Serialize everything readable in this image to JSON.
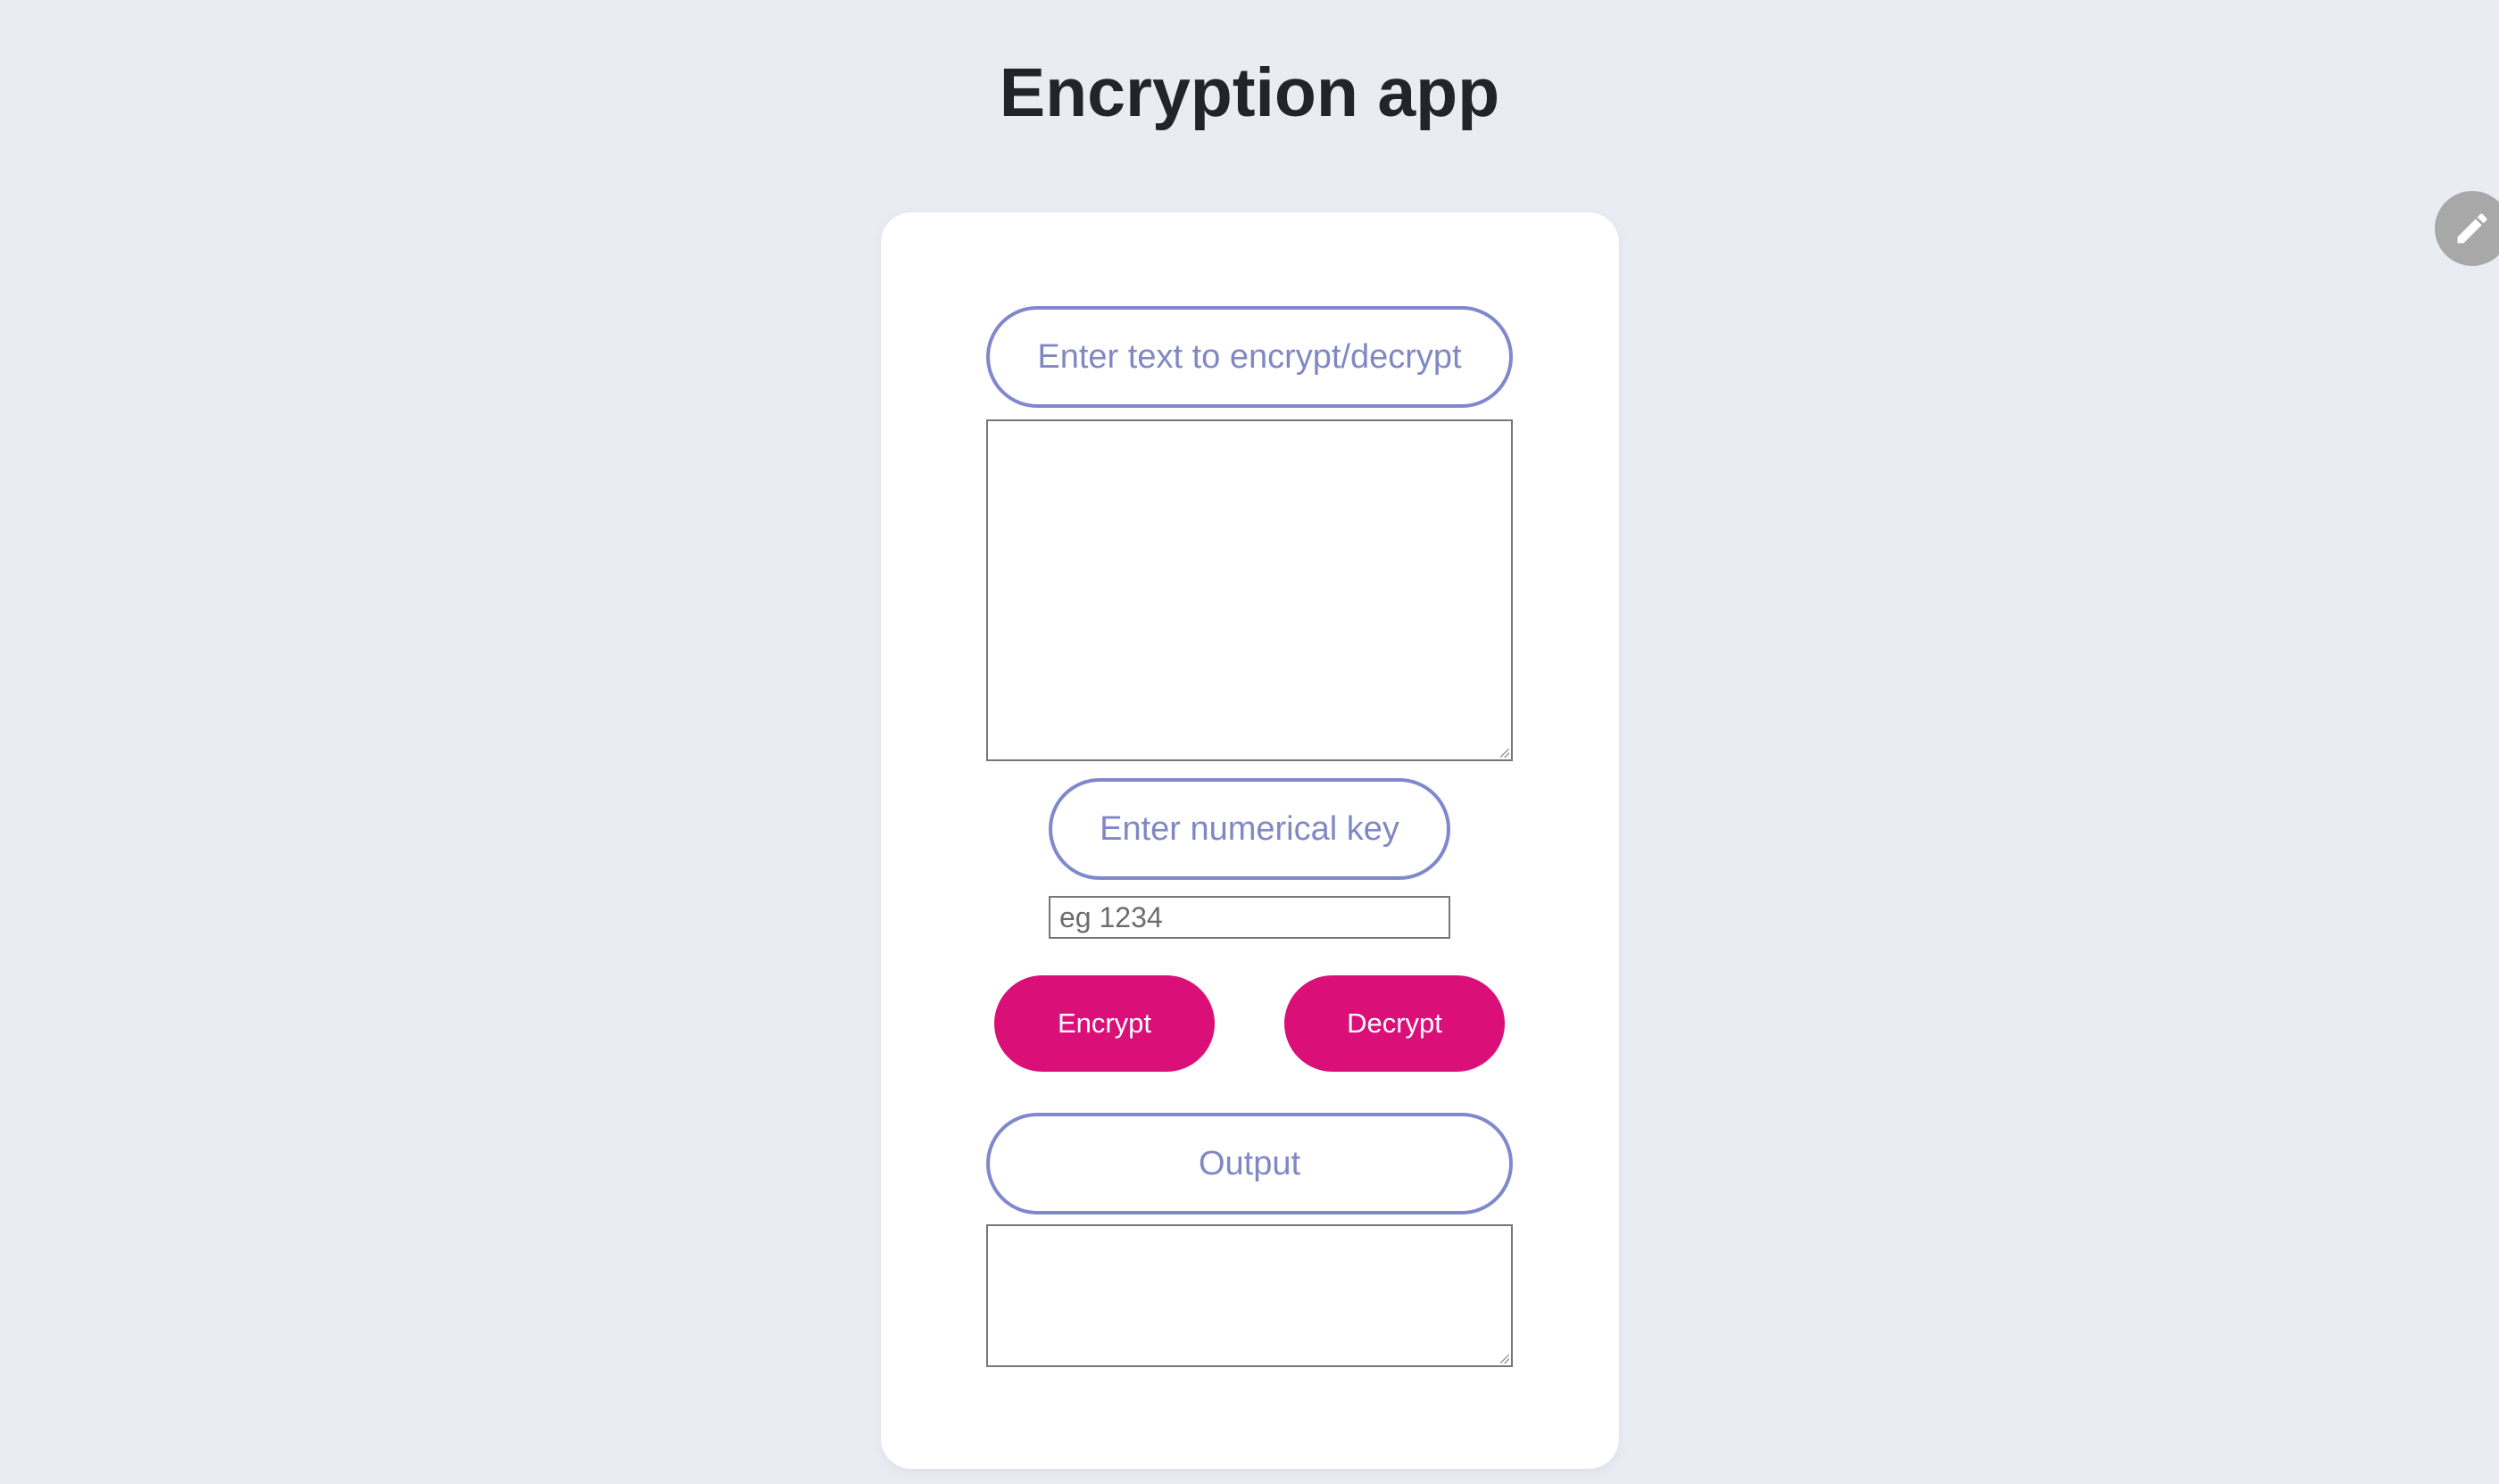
{
  "page": {
    "title": "Encryption app"
  },
  "form": {
    "text_label": "Enter text to encrypt/decrypt",
    "text_value": "",
    "key_label": "Enter numerical key",
    "key_placeholder": "eg 1234",
    "key_value": "",
    "output_label": "Output",
    "output_value": ""
  },
  "buttons": {
    "encrypt_label": "Encrypt",
    "decrypt_label": "Decrypt"
  },
  "floating": {
    "edit_icon": "pencil-icon"
  },
  "colors": {
    "background": "#e9ecf2",
    "accent": "#db0f78",
    "pill_border": "#7f88cc",
    "pill_text": "#8088c4",
    "title": "#212529"
  }
}
